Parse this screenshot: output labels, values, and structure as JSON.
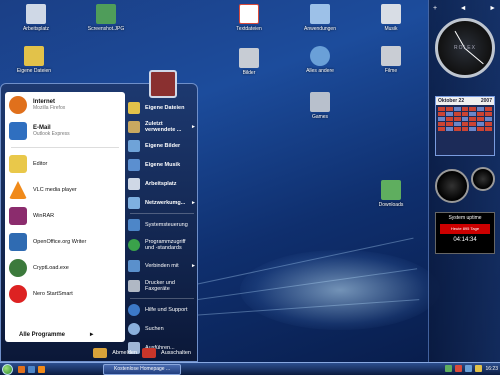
{
  "desktop": {
    "icons": [
      {
        "label": "Arbeitsplatz",
        "color": "#cfd8e6"
      },
      {
        "label": "Screenshot.JPG",
        "color": "#4f9d5a"
      },
      {
        "label": "Eigene Dateien",
        "color": "#e2c24a"
      },
      {
        "label": "Textdateien",
        "color": "#d94b3b"
      },
      {
        "label": "Anwendungen",
        "color": "#9dc1e8"
      },
      {
        "label": "Musik",
        "color": "#d8dde5"
      },
      {
        "label": "Bilder",
        "color": "#c7ccd4"
      },
      {
        "label": "Alles andere",
        "color": "#6aa0d8"
      },
      {
        "label": "Filme",
        "color": "#c9cdd4"
      },
      {
        "label": "Games",
        "color": "#b8c0cc"
      },
      {
        "label": "Downloads",
        "color": "#5fae5f"
      }
    ]
  },
  "sidebar": {
    "clock_label": "ROLEX",
    "calendar": {
      "month": "Oktober 22",
      "year": "2007"
    },
    "uptime": {
      "title": "System uptime",
      "bar": "Heute 895 Tage",
      "value": "04:14:34"
    }
  },
  "start_menu": {
    "pinned": [
      {
        "title": "Internet",
        "subtitle": "Mozilla Firefox",
        "color": "#e0701c"
      },
      {
        "title": "E-Mail",
        "subtitle": "Outlook Express",
        "color": "#2f6fc0"
      }
    ],
    "recent": [
      {
        "label": "Editor",
        "color": "#e9c84a"
      },
      {
        "label": "VLC media player",
        "color": "#f08a1a"
      },
      {
        "label": "WinRAR",
        "color": "#8b2c6d"
      },
      {
        "label": "OpenOffice.org Writer",
        "color": "#2f6bb2"
      },
      {
        "label": "CryptLoad.exe",
        "color": "#3c7a3c"
      },
      {
        "label": "Nero StartSmart",
        "color": "#d22"
      }
    ],
    "all_programs": "Alle Programme",
    "all_programs_arrow": "►",
    "right_items": [
      {
        "label": "Eigene Dateien",
        "bold": true,
        "color": "#e2c24a",
        "more": ""
      },
      {
        "label": "Zuletzt verwendete ...",
        "bold": true,
        "color": "#c8a860",
        "more": "►"
      },
      {
        "label": "Eigene Bilder",
        "bold": true,
        "color": "#6fa3d8",
        "more": ""
      },
      {
        "label": "Eigene Musik",
        "bold": true,
        "color": "#5b8fd0",
        "more": ""
      },
      {
        "label": "Arbeitsplatz",
        "bold": true,
        "color": "#cfd8e6",
        "more": ""
      },
      {
        "label": "Netzwerkumg...",
        "bold": true,
        "color": "#7fb0e0",
        "more": "►"
      },
      {
        "label": "Systemsteuerung",
        "bold": false,
        "color": "#4d86c8",
        "more": ""
      },
      {
        "label": "Programmzugriff und -standards",
        "bold": false,
        "color": "#3aa24a",
        "more": ""
      },
      {
        "label": "Verbinden mit",
        "bold": false,
        "color": "#5a90cc",
        "more": "►"
      },
      {
        "label": "Drucker und Faxgeräte",
        "bold": false,
        "color": "#b0b8c4",
        "more": ""
      },
      {
        "label": "Hilfe und Support",
        "bold": false,
        "color": "#3c79c8",
        "more": ""
      },
      {
        "label": "Suchen",
        "bold": false,
        "color": "#8ab0dc",
        "more": ""
      },
      {
        "label": "Ausführen...",
        "bold": false,
        "color": "#9fb6d6",
        "more": ""
      }
    ],
    "logoff": "Abmelden",
    "shutdown": "Ausschalten"
  },
  "taskbar": {
    "task_label": "Kostenlose Homepage ...",
    "time": "16:23"
  }
}
